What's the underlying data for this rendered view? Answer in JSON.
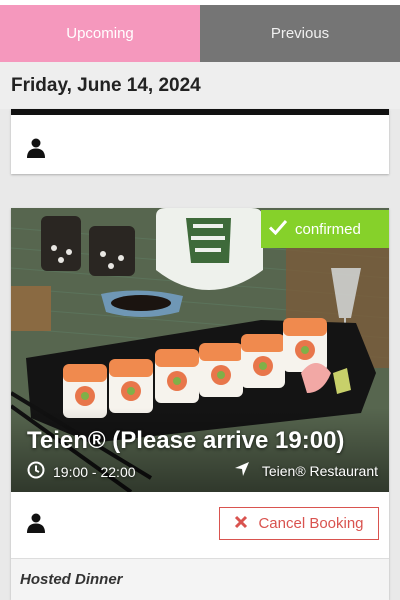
{
  "tabs": [
    {
      "label": "Upcoming",
      "active": true
    },
    {
      "label": "Previous",
      "active": false
    }
  ],
  "date_header": "Friday, June 14, 2024",
  "colors": {
    "tab_active": "#f598bd",
    "tab_inactive": "#757575",
    "confirmed": "#86d12a",
    "cancel": "#d9534f"
  },
  "cards": [
    {
      "icons": [
        "user-icon"
      ]
    },
    {
      "status": "confirmed",
      "title": "Teien® (Please arrive 19:00)",
      "time": "19:00 - 22:00",
      "location": "Teien® Restaurant",
      "cancel_label": "Cancel Booking",
      "section_label": "Hosted Dinner",
      "icons": [
        "check-icon",
        "clock-icon",
        "location-arrow-icon",
        "user-icon",
        "close-icon"
      ]
    }
  ]
}
